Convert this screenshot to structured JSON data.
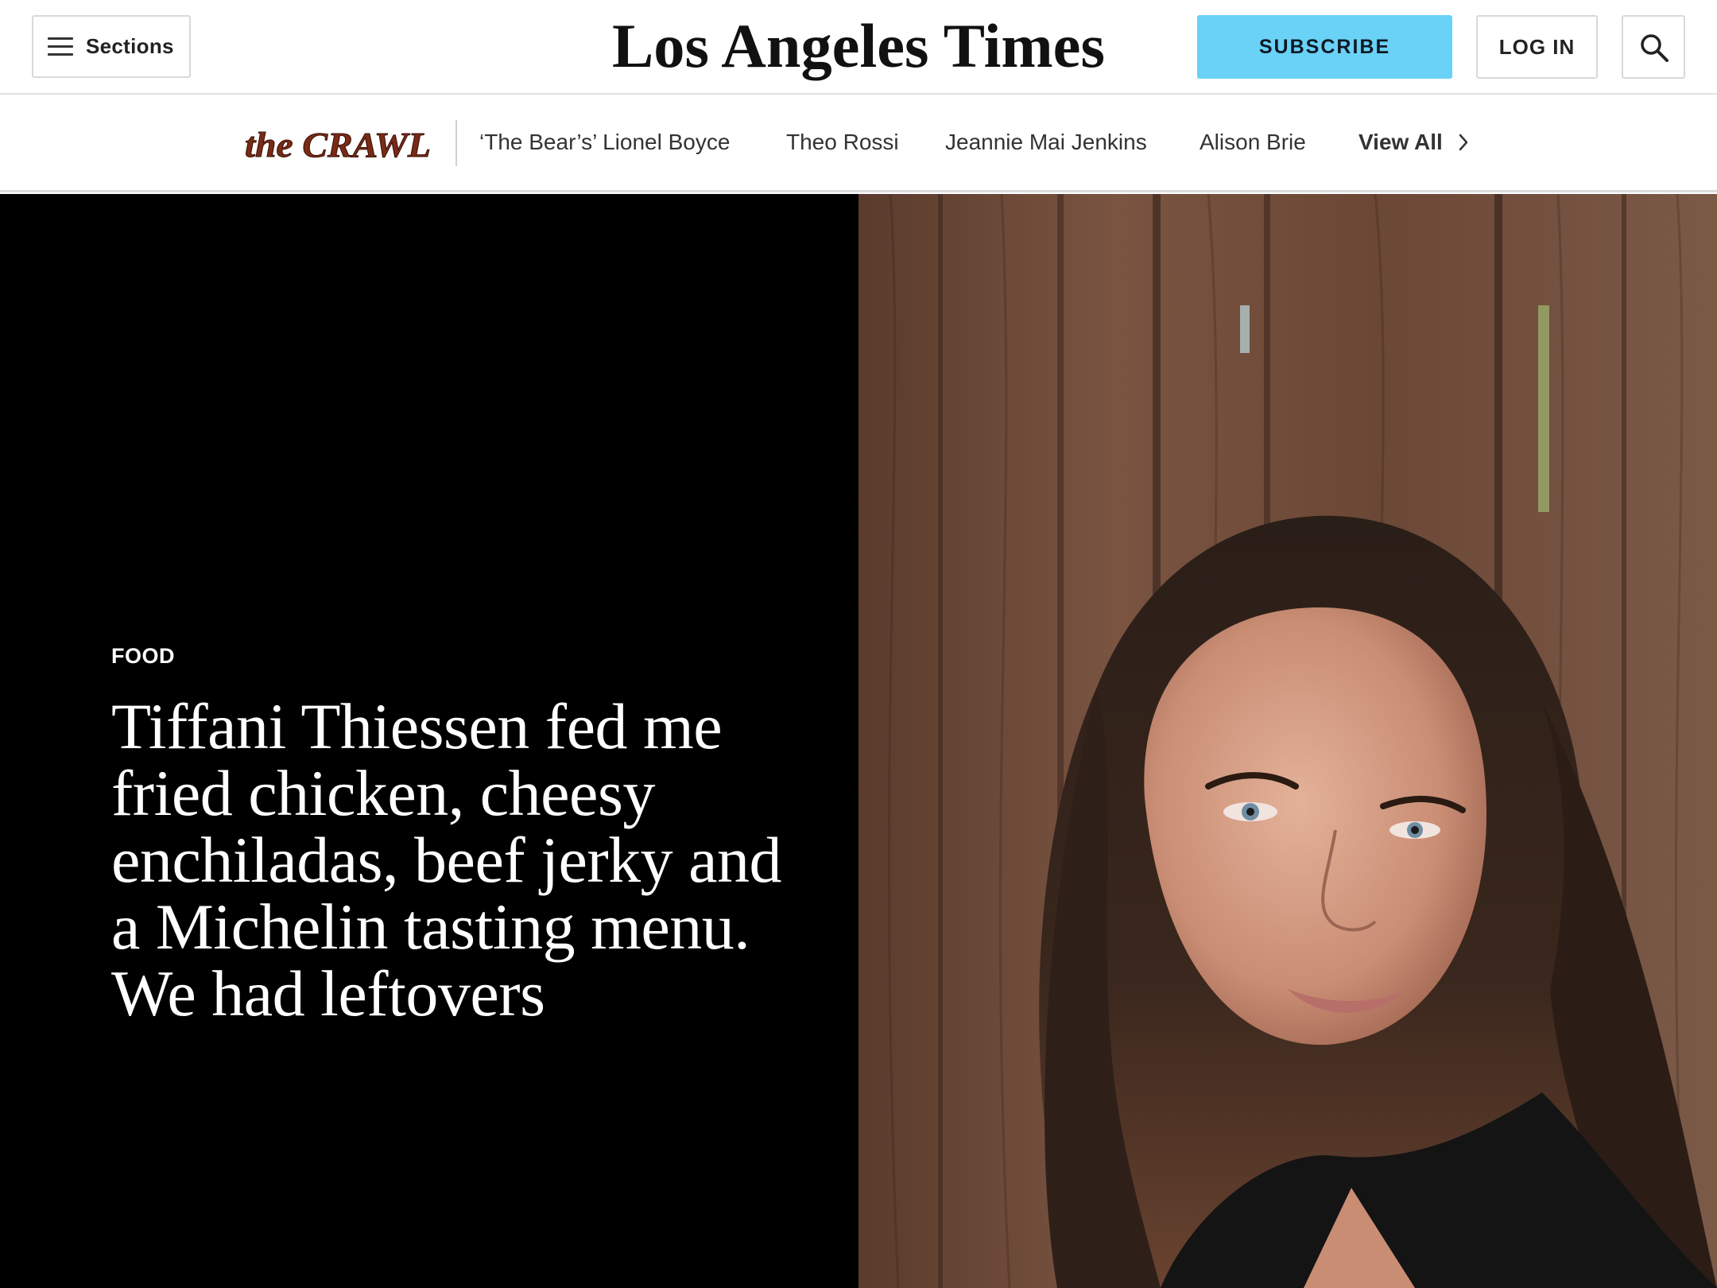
{
  "header": {
    "sections_label": "Sections",
    "masthead_title": "Los Angeles Times",
    "subscribe_label": "SUBSCRIBE",
    "login_label": "LOG IN",
    "colors": {
      "subscribe_bg": "#6ad1f7",
      "border": "#d9d9d9"
    },
    "icons": {
      "menu": "hamburger-icon",
      "search": "search-icon"
    }
  },
  "crawl_nav": {
    "logo_text": "the CRAWL",
    "links": [
      "‘The Bear’s’ Lionel Boyce",
      "Theo Rossi",
      "Jeannie Mai Jenkins",
      "Alison Brie"
    ],
    "view_all_label": "View All",
    "colors": {
      "logo": "#7a2a16"
    },
    "icons": {
      "view_all": "chevron-right-icon"
    }
  },
  "hero": {
    "category": "FOOD",
    "headline": "Tiffani Thiessen fed me fried chicken, cheesy enchiladas, beef jerky and a Michelin tasting menu. We had leftovers",
    "colors": {
      "panel_bg": "#000000",
      "text": "#ffffff"
    }
  }
}
